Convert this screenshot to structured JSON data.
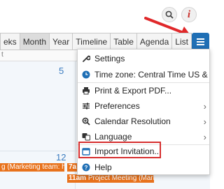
{
  "top_icons": {
    "search": "search-icon",
    "info": "info-icon",
    "info_glyph": "i"
  },
  "toolbar": {
    "views": [
      "eks",
      "Month",
      "Year",
      "Timeline",
      "Table",
      "Agenda",
      "List"
    ],
    "active_view": "Month",
    "menu_icon": "hamburger-icon"
  },
  "calendar": {
    "day_header": "t",
    "day_numbers": [
      "5",
      "12"
    ],
    "events": [
      {
        "time": "",
        "title": "g (Marketing team: htt"
      },
      {
        "time": "7a",
        "title": ""
      },
      {
        "time": "11am",
        "title": "Project Meeting (Marketing team: htt"
      }
    ]
  },
  "menu": {
    "items": [
      {
        "label": "Settings",
        "icon": "wrench-icon",
        "submenu": false
      },
      {
        "label": "Time zone: Central Time US & Ca",
        "icon": "clock-icon",
        "submenu": false
      },
      {
        "label": "Print & Export PDF...",
        "icon": "printer-icon",
        "submenu": false
      },
      {
        "label": "Preferences",
        "icon": "sliders-icon",
        "submenu": true
      },
      {
        "label": "Calendar Resolution",
        "icon": "magnify-icon",
        "submenu": true
      },
      {
        "label": "Language",
        "icon": "language-icon",
        "submenu": true
      },
      {
        "label": "Import Invitation...",
        "icon": "calendar-icon",
        "submenu": false
      },
      {
        "label": "Help",
        "icon": "help-icon",
        "submenu": false
      }
    ],
    "highlighted": "Import Invitation..."
  },
  "colors": {
    "accent": "#1f6fb5",
    "event": "#e8721c",
    "highlight": "#d62e2e",
    "arrow": "#e0282a"
  }
}
